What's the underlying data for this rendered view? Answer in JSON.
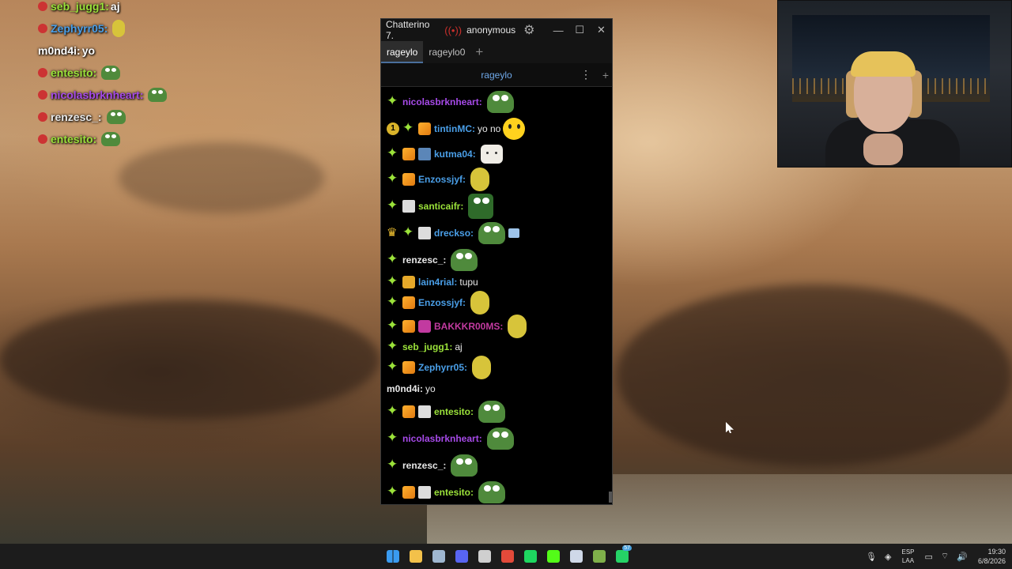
{
  "overlay_chat": [
    {
      "user": "seb_jugg1:",
      "color": "#9be23a",
      "message": "aj",
      "emote": null
    },
    {
      "user": "Zephyrr05:",
      "color": "#4a9fe8",
      "message": "",
      "emote": "banana"
    },
    {
      "user": "m0nd4i:",
      "color": "#ffffff",
      "message": "yo",
      "emote": null
    },
    {
      "user": "entesito:",
      "color": "#9be23a",
      "message": "",
      "emote": "pepe"
    },
    {
      "user": "nicolasbrknheart:",
      "color": "#a64ae8",
      "message": "",
      "emote": "pepe"
    },
    {
      "user": "renzesc_:",
      "color": "#e8e8e8",
      "message": "",
      "emote": "pepe"
    },
    {
      "user": "entesito:",
      "color": "#9be23a",
      "message": "",
      "emote": "pepe"
    }
  ],
  "window": {
    "title": "Chatterino 7.",
    "account": "anonymous",
    "min_icon": "minimize-icon",
    "max_icon": "maximize-icon",
    "close_icon": "close-icon"
  },
  "tabs": [
    {
      "label": "rageylo",
      "active": true
    },
    {
      "label": "rageylo0",
      "active": false
    }
  ],
  "split": {
    "channel": "rageylo"
  },
  "messages": [
    {
      "badges": [
        "prime"
      ],
      "user": "nicolasbrknheart:",
      "color": "#a64ae8",
      "text": "",
      "emotes": [
        "pepe"
      ]
    },
    {
      "badges": [
        "pin",
        "prime",
        "box"
      ],
      "user": "tintinMC:",
      "color": "#4a9fe8",
      "text": "yo no",
      "emotes": [
        "smile"
      ]
    },
    {
      "badges": [
        "prime",
        "box",
        "tile"
      ],
      "user": "kutma04:",
      "color": "#4a9fe8",
      "text": "",
      "emotes": [
        "cat"
      ]
    },
    {
      "badges": [
        "prime",
        "box"
      ],
      "user": "Enzossjyf:",
      "color": "#4a9fe8",
      "text": "",
      "emotes": [
        "banana"
      ]
    },
    {
      "badges": [
        "prime",
        "mono"
      ],
      "user": "santicaifr:",
      "color": "#9be23a",
      "text": "",
      "emotes": [
        "dark"
      ]
    },
    {
      "badges": [
        "crown",
        "prime",
        "mono"
      ],
      "user": "dreckso:",
      "color": "#4a9fe8",
      "text": "",
      "emotes": [
        "pepe",
        "small"
      ]
    },
    {
      "badges": [
        "prime"
      ],
      "user": "renzesc_:",
      "color": "#e8e8e8",
      "text": "",
      "emotes": [
        "pepe"
      ]
    },
    {
      "badges": [
        "prime",
        "yel"
      ],
      "user": "lain4rial:",
      "color": "#4a9fe8",
      "text": "tupu",
      "emotes": []
    },
    {
      "badges": [
        "prime",
        "box"
      ],
      "user": "Enzossjyf:",
      "color": "#4a9fe8",
      "text": "",
      "emotes": [
        "banana"
      ]
    },
    {
      "badges": [
        "prime",
        "box",
        "gift"
      ],
      "user": "BAKKKR00MS:",
      "color": "#c23aa0",
      "text": "",
      "emotes": [
        "banana"
      ]
    },
    {
      "badges": [
        "prime"
      ],
      "user": "seb_jugg1:",
      "color": "#9be23a",
      "text": "aj",
      "emotes": []
    },
    {
      "badges": [
        "prime",
        "box"
      ],
      "user": "Zephyrr05:",
      "color": "#4a9fe8",
      "text": "",
      "emotes": [
        "banana"
      ]
    },
    {
      "badges": [],
      "user": "m0nd4i:",
      "color": "#e8e8e8",
      "text": "yo",
      "emotes": []
    },
    {
      "badges": [
        "prime",
        "box",
        "mono"
      ],
      "user": "entesito:",
      "color": "#9be23a",
      "text": "",
      "emotes": [
        "pepe"
      ]
    },
    {
      "badges": [
        "prime"
      ],
      "user": "nicolasbrknheart:",
      "color": "#a64ae8",
      "text": "",
      "emotes": [
        "pepe"
      ]
    },
    {
      "badges": [
        "prime"
      ],
      "user": "renzesc_:",
      "color": "#e8e8e8",
      "text": "",
      "emotes": [
        "pepe"
      ]
    },
    {
      "badges": [
        "prime",
        "box",
        "mono"
      ],
      "user": "entesito:",
      "color": "#9be23a",
      "text": "",
      "emotes": [
        "pepe"
      ]
    }
  ],
  "taskbar": {
    "apps": [
      {
        "name": "start-icon",
        "color": "#3a9bf0"
      },
      {
        "name": "file-explorer-icon",
        "color": "#f3c14a"
      },
      {
        "name": "steam-icon",
        "color": "#9fb7d0"
      },
      {
        "name": "discord-icon",
        "color": "#5865f2"
      },
      {
        "name": "obs-icon",
        "color": "#cfcfcf"
      },
      {
        "name": "chrome-icon",
        "color": "#e34a3a"
      },
      {
        "name": "spotify-icon",
        "color": "#1ed760"
      },
      {
        "name": "stream-app-icon",
        "color": "#53fc18"
      },
      {
        "name": "chatterino-icon",
        "color": "#cfd8e8"
      },
      {
        "name": "game-icon",
        "color": "#7fb04a"
      },
      {
        "name": "whatsapp-icon",
        "color": "#25d366",
        "count": "57"
      }
    ],
    "lang_top": "ESP",
    "lang_bottom": "LAA",
    "time": "19:30",
    "date": "6/8/2026"
  }
}
